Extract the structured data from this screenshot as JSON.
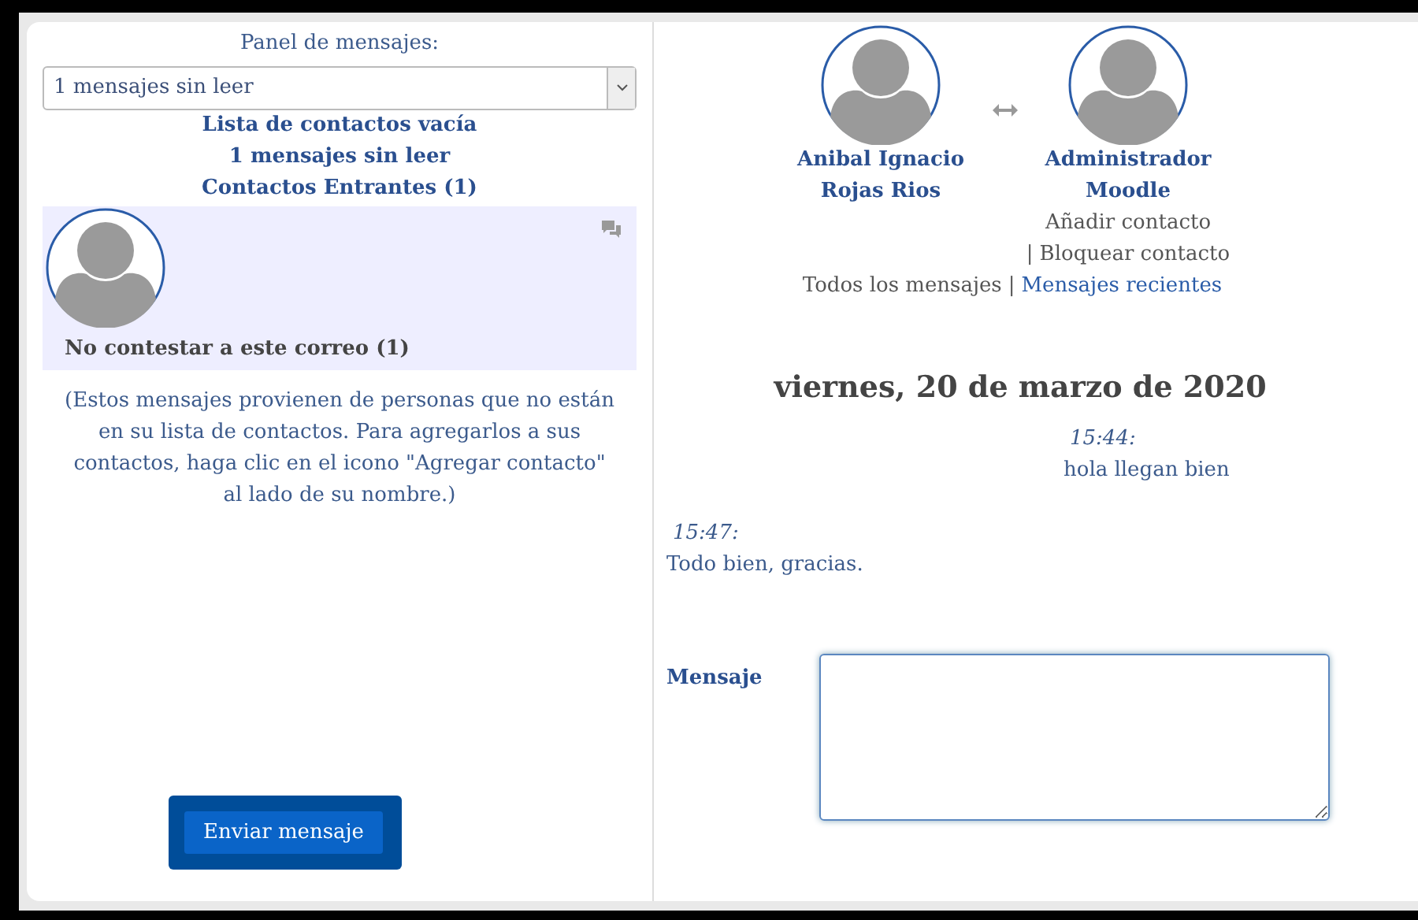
{
  "left_panel": {
    "title": "Panel de mensajes:",
    "view_select": {
      "value": "1 mensajes sin leer"
    },
    "headings": [
      "Lista de contactos vacía",
      "1 mensajes sin leer",
      "Contactos Entrantes (1)"
    ],
    "contacts": [
      {
        "name": "No contestar a este correo (1)",
        "selected": true
      }
    ],
    "note": "(Estos mensajes provienen de personas que no están en su lista de contactos. Para agregarlos a sus contactos, haga clic en el icono \"Agregar contacto\" al lado de su nombre.)",
    "send_button": "Enviar mensaje"
  },
  "conversation": {
    "users": [
      {
        "name": "Anibal Ignacio Rojas Rios"
      },
      {
        "name": "Administrador Moodle"
      }
    ],
    "contact_actions": {
      "items": [
        "Añadir contacto",
        "Bloquear contacto"
      ],
      "separator": "|"
    },
    "history_links": {
      "items": [
        {
          "label": "Todos los mensajes",
          "selected": true
        },
        {
          "label": "Mensajes recientes",
          "selected": false
        }
      ],
      "separator": "|"
    },
    "date": "viernes, 20 de marzo de 2020",
    "messages": [
      {
        "kind": "received",
        "time": "15:44:",
        "text": "hola llegan bien"
      },
      {
        "kind": "sent",
        "time": "15:47:",
        "text": "Todo bien, gracias."
      }
    ],
    "message_field": {
      "label": "Mensaje"
    }
  }
}
